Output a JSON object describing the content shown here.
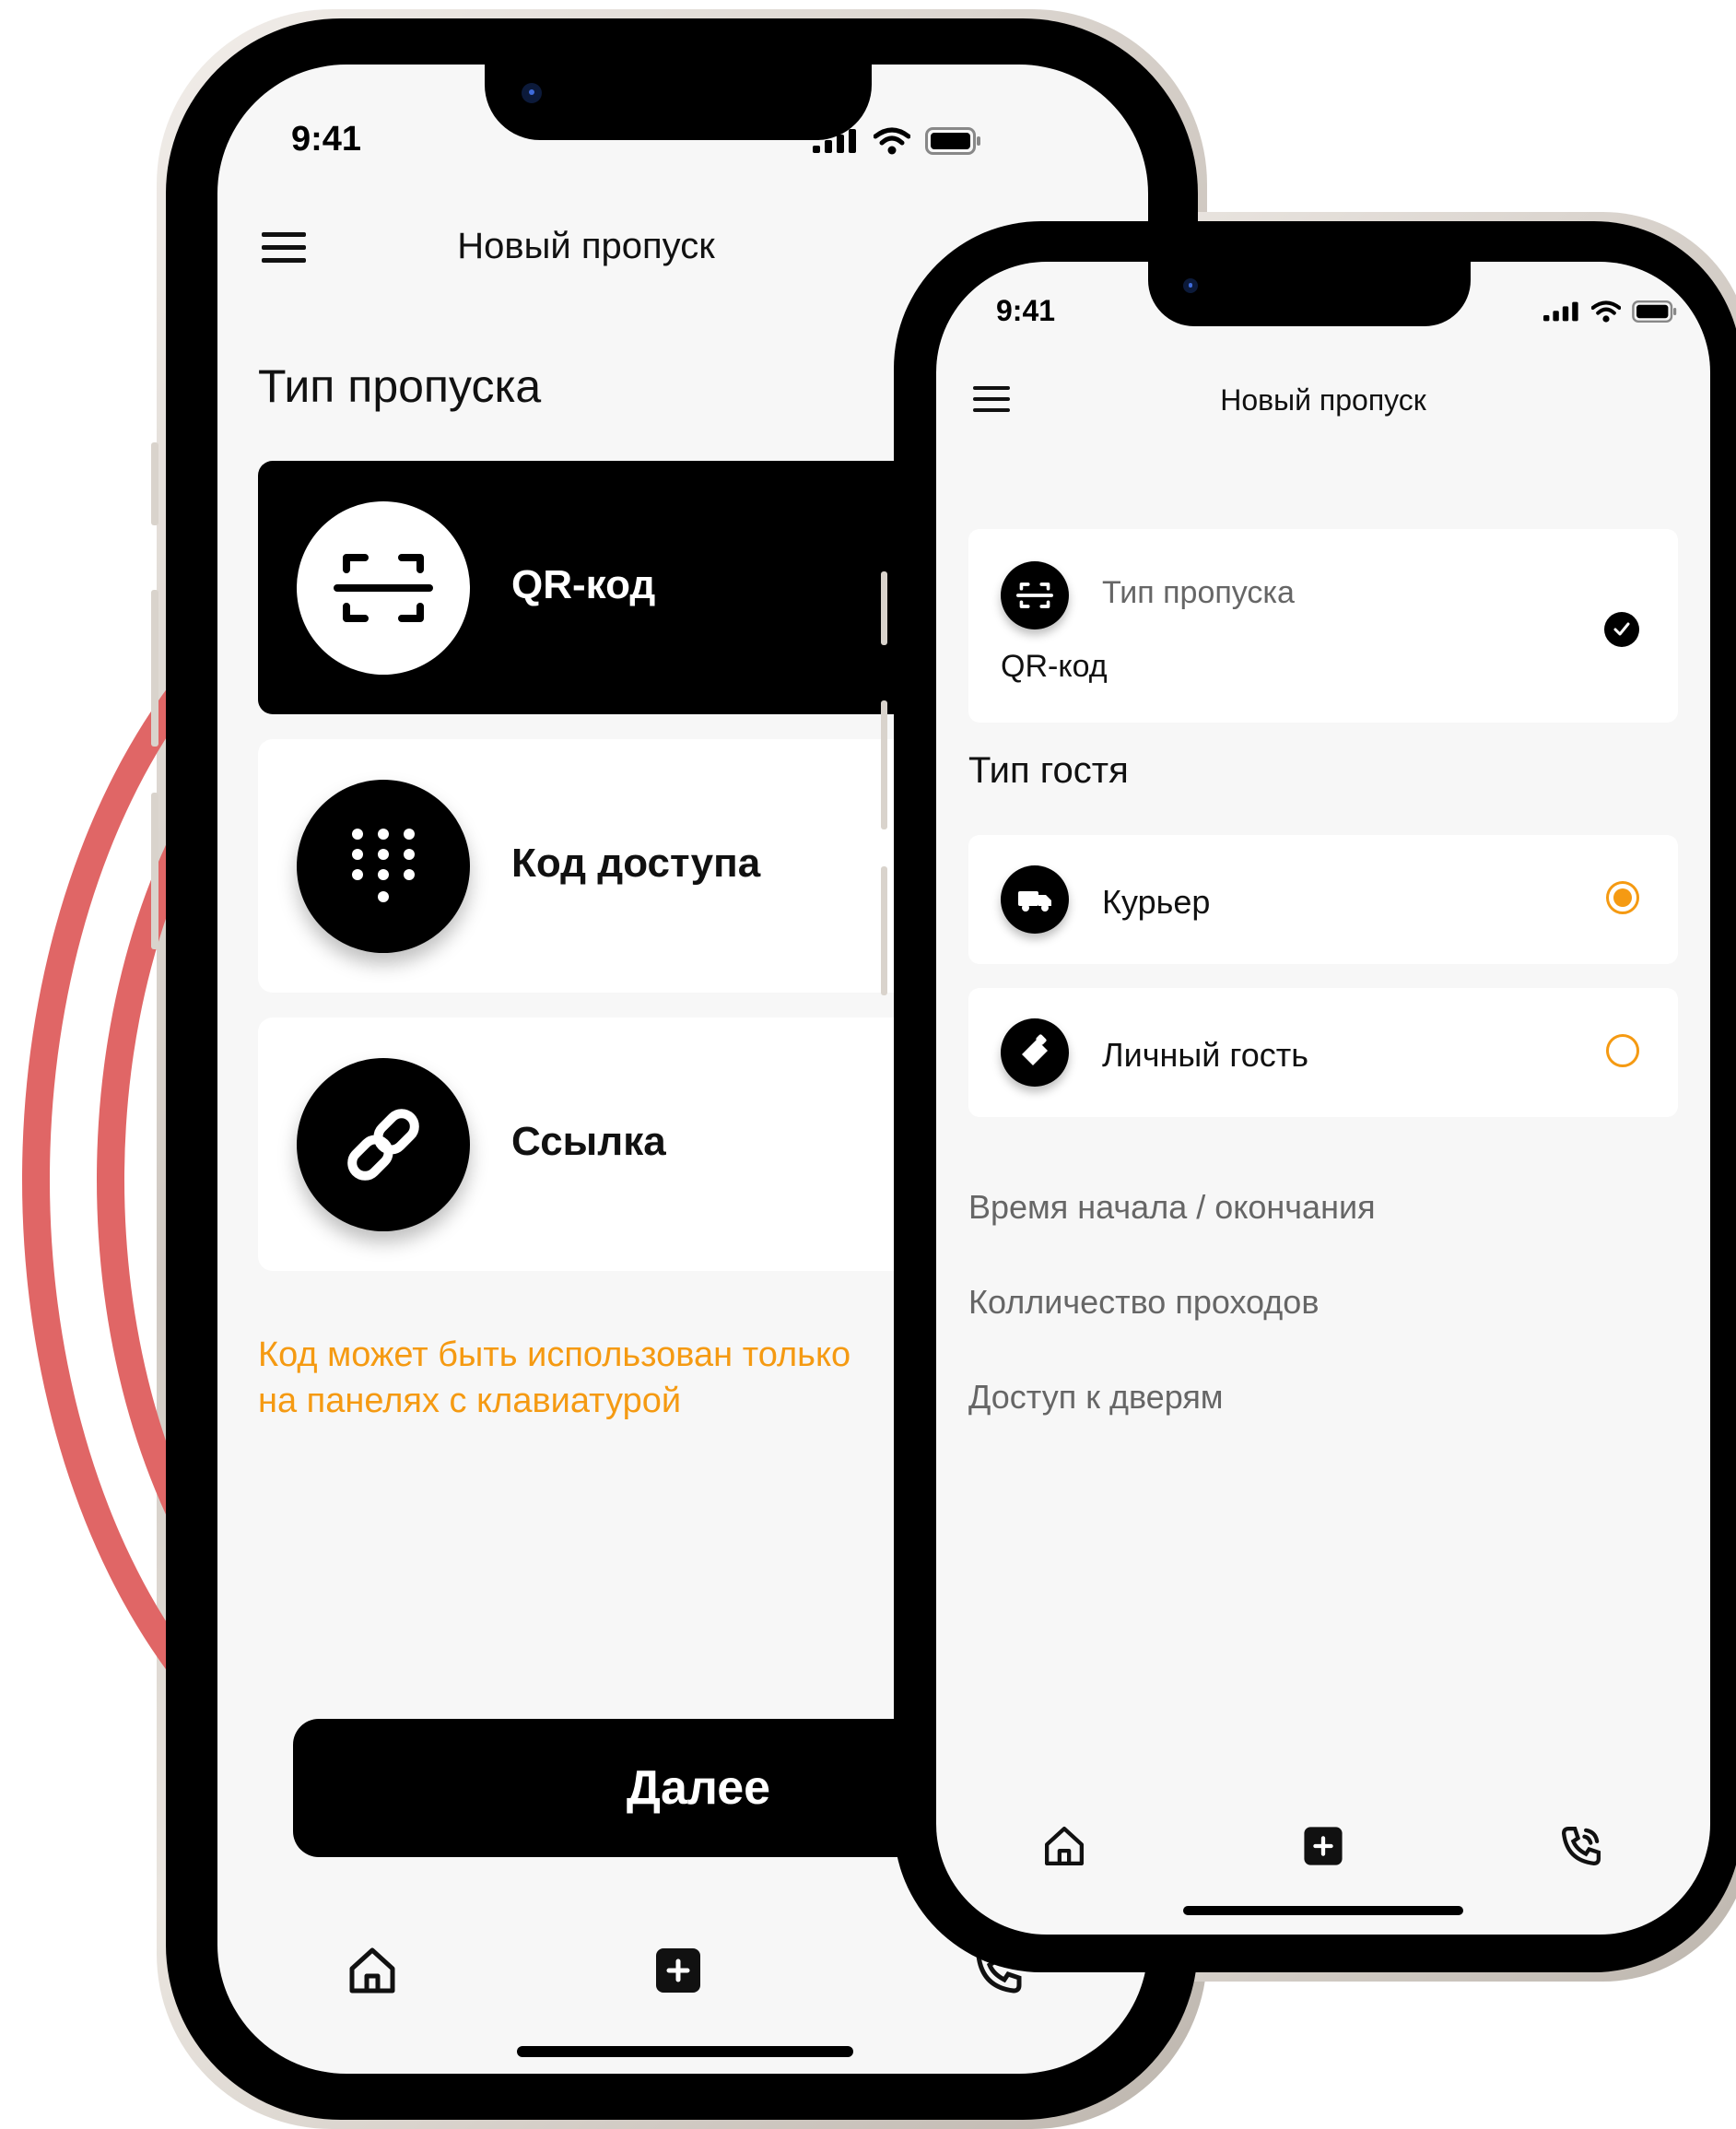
{
  "accent_color": "#f59a12",
  "decor_color": "#e06666",
  "phone_left": {
    "status": {
      "time": "9:41"
    },
    "header": {
      "title": "Новый пропуск",
      "menu_icon": "menu-icon"
    },
    "section_title": "Тип пропуска",
    "options": [
      {
        "label": "QR-код",
        "icon": "qr-scan-icon",
        "selected": true
      },
      {
        "label": "Код доступа",
        "icon": "keypad-icon",
        "selected": false
      },
      {
        "label": "Ссылка",
        "icon": "link-icon",
        "selected": false
      }
    ],
    "note_line1": "Код может быть использован только",
    "note_line2": "на панелях с клавиатурой",
    "next_button": "Далее",
    "tabbar": [
      "home-icon",
      "add-icon",
      "phone-call-icon"
    ]
  },
  "phone_right": {
    "status": {
      "time": "9:41"
    },
    "header": {
      "title": "Новый пропуск",
      "menu_icon": "menu-icon"
    },
    "pass_type": {
      "title": "Тип пропуска",
      "value": "QR-код",
      "done": true
    },
    "guest_section_title": "Тип гостя",
    "guest_types": [
      {
        "label": "Курьер",
        "icon": "truck-icon",
        "selected": true
      },
      {
        "label": "Личный гость",
        "icon": "badge-icon",
        "selected": false
      }
    ],
    "links": [
      "Время начала / окончания",
      "Колличество проходов",
      "Доступ к дверям"
    ],
    "tabbar": [
      "home-icon",
      "add-icon",
      "phone-call-icon"
    ]
  }
}
